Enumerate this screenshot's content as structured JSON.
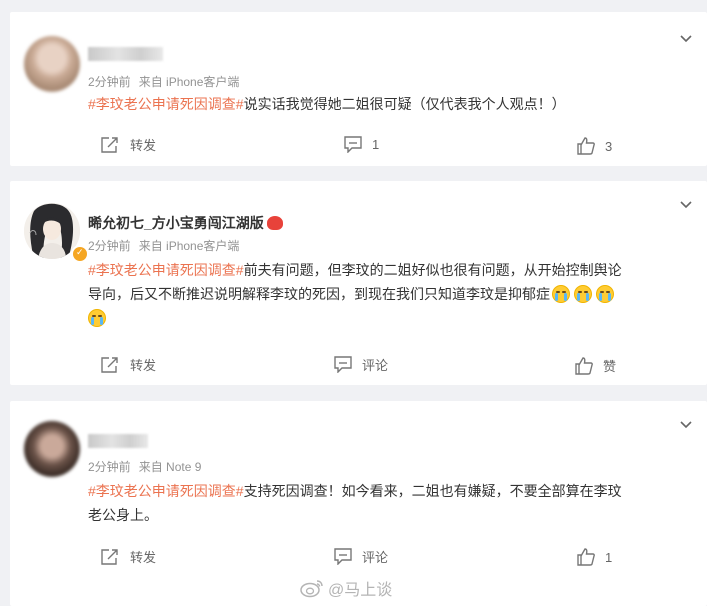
{
  "comments": [
    {
      "name": "",
      "time": "2分钟前",
      "source": "来自 iPhone客户端",
      "tag": "#李玟老公申请死因调查#",
      "text": "说实话我觉得她二姐很可疑（仅代表我个人观点！）",
      "repost_label": "转发",
      "comment_count": "1",
      "like_count": "3"
    },
    {
      "name": "晞允初七_方小宝勇闯江湖版",
      "time": "2分钟前",
      "source": "来自 iPhone客户端",
      "tag": "#李玟老公申请死因调查#",
      "text_line1": "前夫有问题，但李玟的二姐好似也很有问题，从开始控制舆论",
      "text_line2": "导向，后又不断推迟说明解释李玟的死因，到现在我们只知道李玟是抑郁症",
      "repost_label": "转发",
      "comment_label": "评论",
      "like_label": "赞"
    },
    {
      "name": "",
      "time": "2分钟前",
      "source": "来自 Note 9",
      "tag": "#李玟老公申请死因调查#",
      "text_line1": "支持死因调查！如今看来，二姐也有嫌疑，不要全部算在李玟",
      "text_line2": "老公身上。",
      "repost_label": "转发",
      "comment_label": "评论",
      "like_count": "1"
    }
  ],
  "watermark": "@马上谈",
  "colors": {
    "tag": "#eb7350",
    "background": "#f0f1f4",
    "card": "#ffffff",
    "meta": "#939393"
  }
}
